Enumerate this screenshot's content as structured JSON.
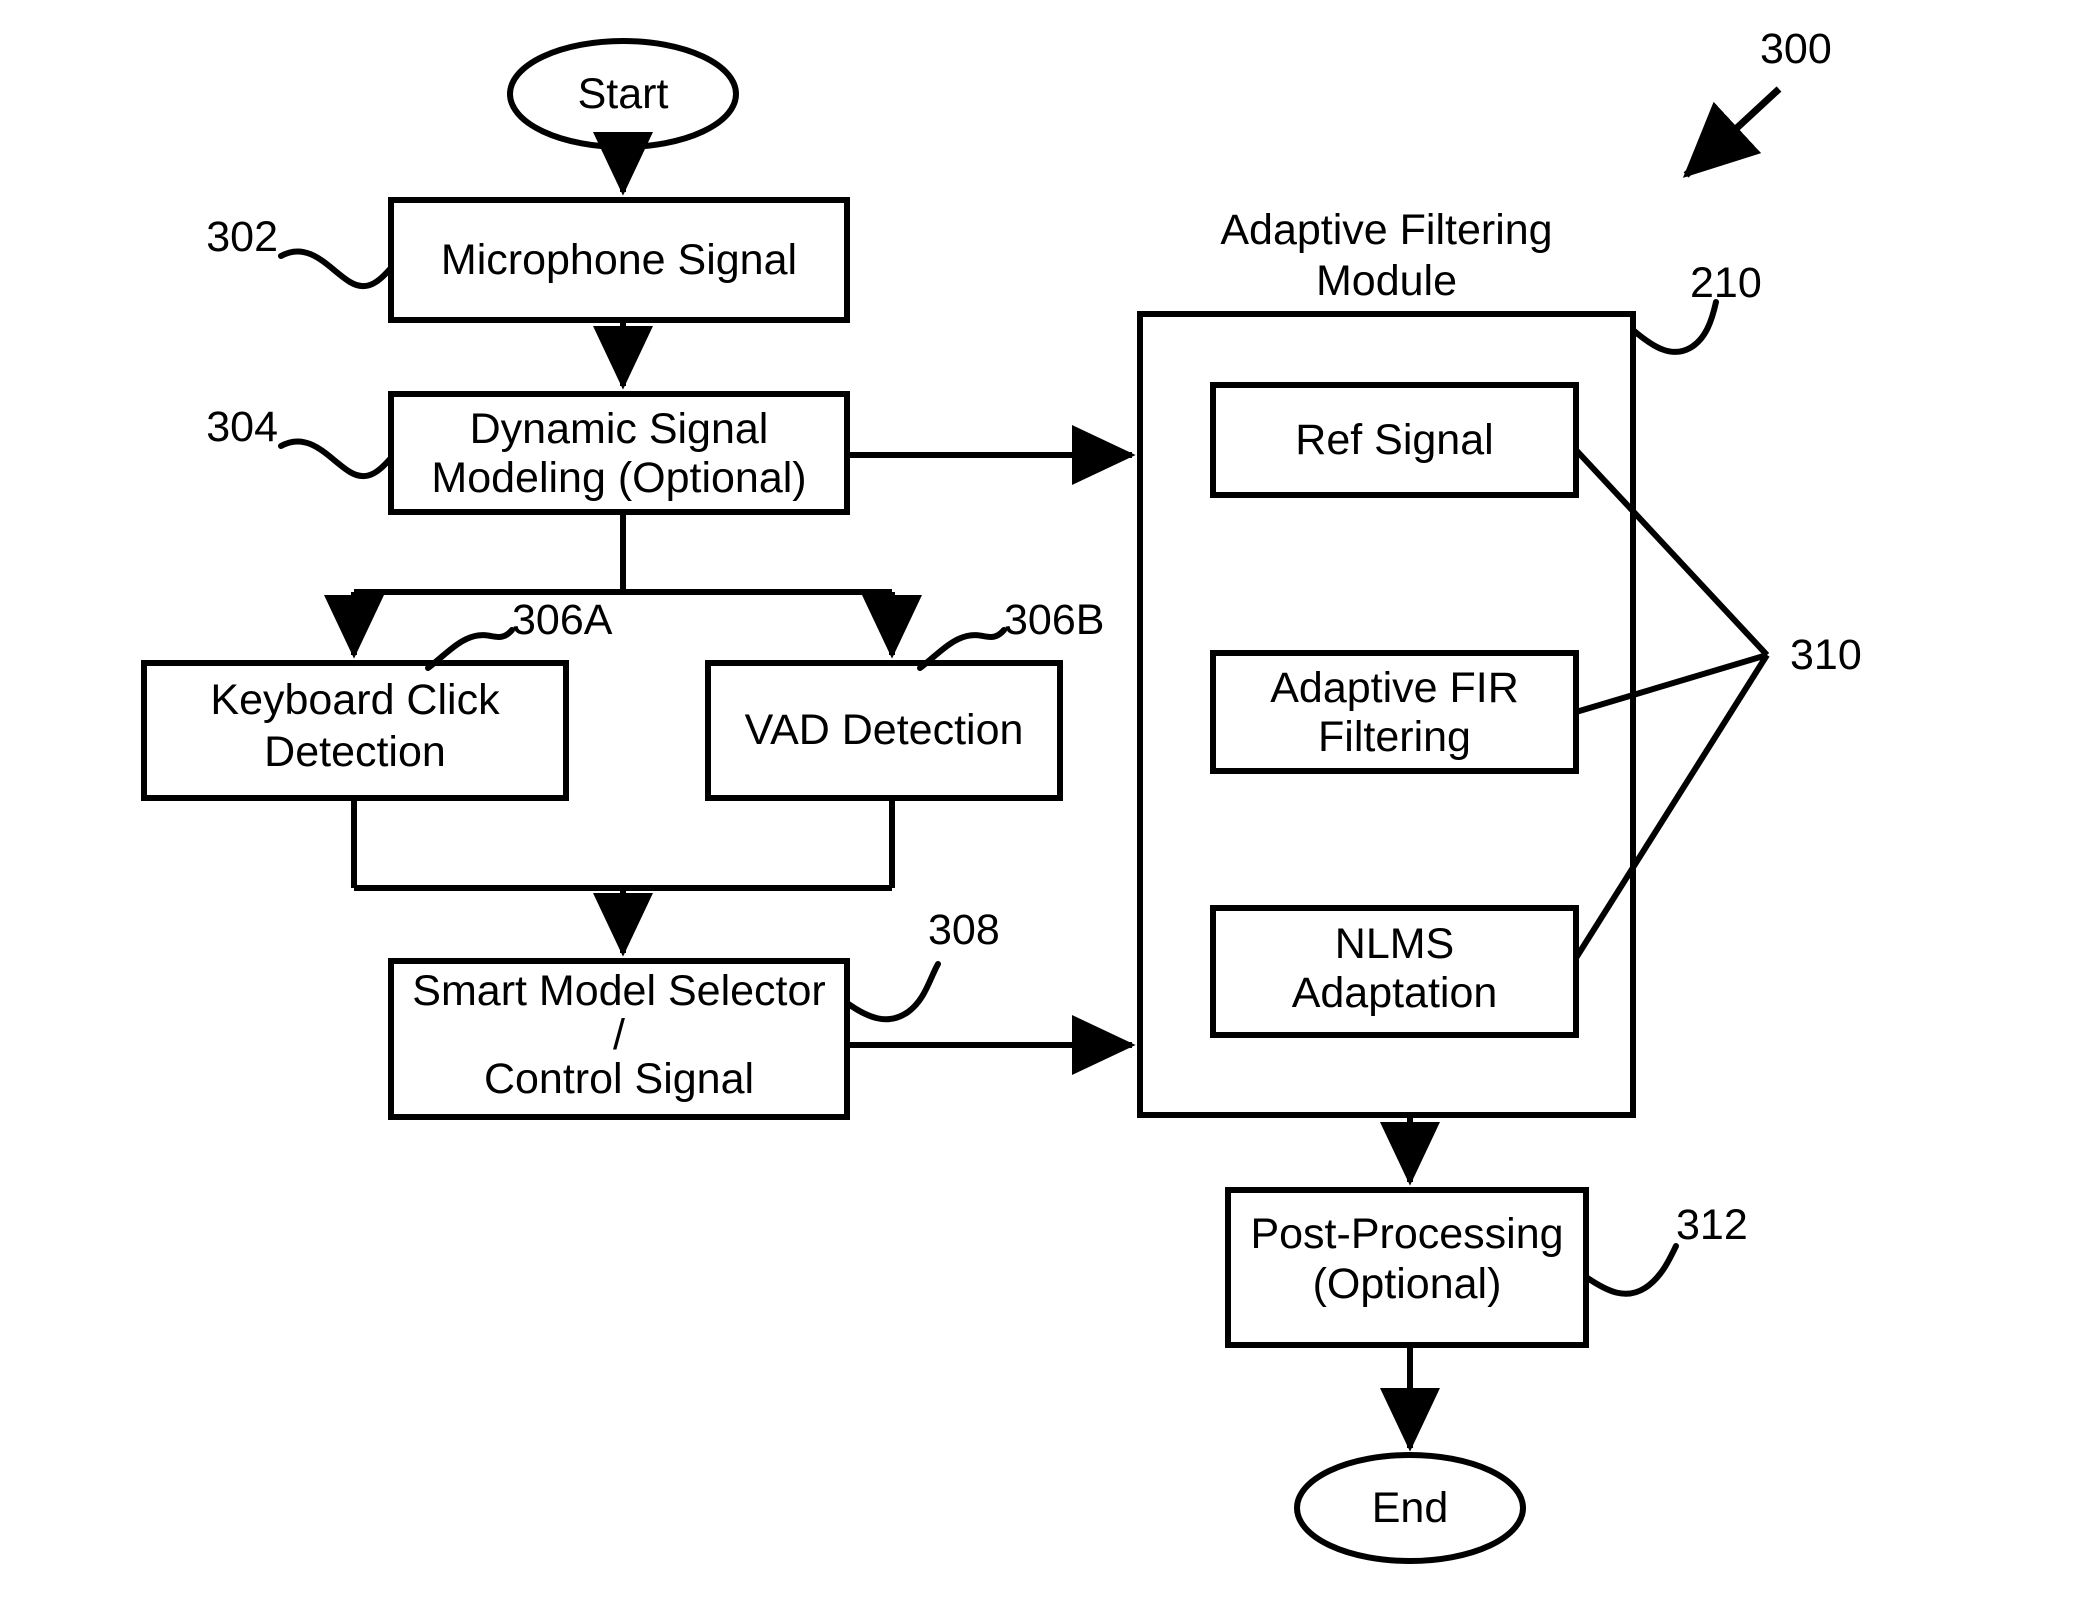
{
  "figure": {
    "number": "300",
    "title_ref": "300"
  },
  "terminators": {
    "start": "Start",
    "end": "End"
  },
  "module": {
    "title_line1": "Adaptive Filtering",
    "title_line2": "Module",
    "ref": "210",
    "inner_ref": "310",
    "inner_blocks": [
      {
        "label": "Ref Signal",
        "line1": "Ref Signal",
        "line2": ""
      },
      {
        "label": "Adaptive FIR Filtering",
        "line1": "Adaptive FIR",
        "line2": "Filtering"
      },
      {
        "label": "NLMS Adaptation",
        "line1": "NLMS",
        "line2": "Adaptation"
      }
    ]
  },
  "nodes": [
    {
      "id": "microphone_signal",
      "ref": "302",
      "line1": "Microphone Signal",
      "line2": "",
      "line3": ""
    },
    {
      "id": "dynamic_signal_modeling",
      "ref": "304",
      "line1": "Dynamic Signal",
      "line2": "Modeling (Optional)",
      "line3": ""
    },
    {
      "id": "keyboard_click_detection",
      "ref": "306A",
      "line1": "Keyboard Click",
      "line2": "Detection",
      "line3": ""
    },
    {
      "id": "vad_detection",
      "ref": "306B",
      "line1": "VAD Detection",
      "line2": "",
      "line3": ""
    },
    {
      "id": "smart_model_selector",
      "ref": "308",
      "line1": "Smart Model Selector",
      "line2": "/",
      "line3": "Control Signal"
    },
    {
      "id": "post_processing",
      "ref": "312",
      "line1": "Post-Processing",
      "line2": "(Optional)",
      "line3": ""
    }
  ],
  "colors": {
    "stroke": "#000000",
    "fill": "#ffffff",
    "text": "#000000"
  }
}
